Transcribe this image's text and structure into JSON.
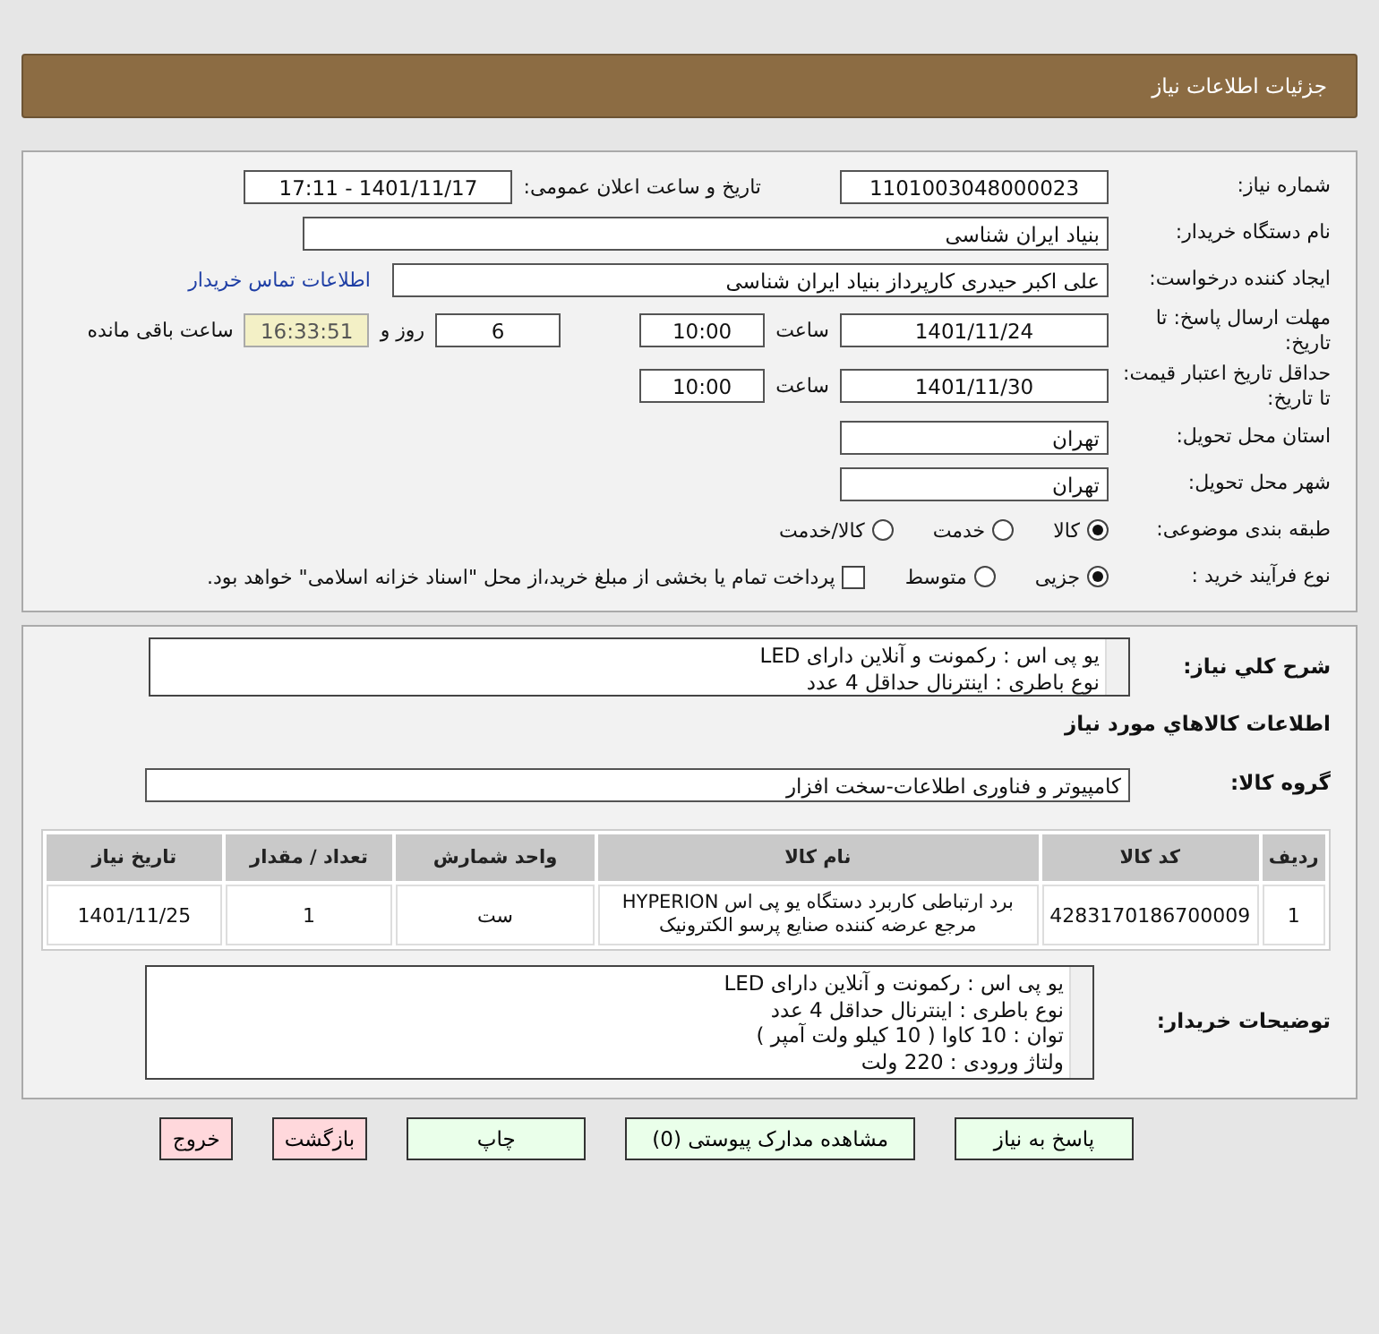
{
  "header": {
    "title": "جزئیات اطلاعات نیاز"
  },
  "details": {
    "need_number": {
      "label": "شماره نیاز:",
      "value": "1101003048000023"
    },
    "announce": {
      "label": "تاریخ و ساعت اعلان عمومی:",
      "value": "1401/11/17 - 17:11"
    },
    "buyer_org": {
      "label": "نام دستگاه خریدار:",
      "value": "بنیاد ایران شناسی"
    },
    "creator": {
      "label": "ایجاد کننده درخواست:",
      "value": "علی اکبر حیدری کارپرداز بنیاد ایران شناسی",
      "link": "اطلاعات تماس خریدار"
    },
    "deadline": {
      "label": "مهلت ارسال پاسخ: تا تاریخ:",
      "date": "1401/11/24",
      "time_label": "ساعت",
      "time": "10:00",
      "days": "6",
      "days_label": "روز و",
      "remaining": "16:33:51",
      "remaining_label": "ساعت باقی مانده"
    },
    "validity": {
      "label": "حداقل تاریخ اعتبار قیمت: تا تاریخ:",
      "date": "1401/11/30",
      "time_label": "ساعت",
      "time": "10:00"
    },
    "province": {
      "label": "استان محل تحویل:",
      "value": "تهران"
    },
    "city": {
      "label": "شهر محل تحویل:",
      "value": "تهران"
    },
    "category": {
      "label": "طبقه بندی موضوعی:",
      "options": [
        {
          "label": "کالا",
          "selected": true
        },
        {
          "label": "خدمت",
          "selected": false
        },
        {
          "label": "کالا/خدمت",
          "selected": false
        }
      ]
    },
    "process": {
      "label": "نوع فرآیند خرید :",
      "options": [
        {
          "label": "جزیی",
          "selected": true
        },
        {
          "label": "متوسط",
          "selected": false
        }
      ],
      "payment": {
        "label": "پرداخت تمام یا بخشی از مبلغ خرید،از محل \"اسناد خزانه اسلامی\" خواهد بود.",
        "checked": false
      }
    }
  },
  "goods": {
    "summary": {
      "label": "شرح کلي نياز:",
      "lines": [
        "یو پی اس : رکمونت و آنلاین دارای LED",
        "نوع باطری : اینترنال حداقل 4 عدد"
      ]
    },
    "section_title": "اطلاعات کالاهاي مورد نياز",
    "group": {
      "label": "گروه کالا:",
      "value": "کامپیوتر و فناوری اطلاعات-سخت افزار"
    },
    "table": {
      "columns": [
        "ردیف",
        "کد کالا",
        "نام کالا",
        "واحد شمارش",
        "تعداد / مقدار",
        "تاریخ نیاز"
      ],
      "rows": [
        [
          "1",
          "4283170186700009",
          "برد ارتباطی کاربرد دستگاه یو پی اس HYPERION مرجع عرضه کننده صنایع پرسو الکترونیک",
          "ست",
          "1",
          "1401/11/25"
        ]
      ]
    },
    "buyer_notes": {
      "label": "توضیحات خریدار:",
      "lines": [
        "یو پی اس : رکمونت و آنلاین دارای LED",
        "نوع باطری : اینترنال حداقل 4 عدد",
        "توان : 10 کاوا ( 10 کیلو ولت آمپر )",
        "ولتاژ ورودی : 220 ولت"
      ]
    }
  },
  "buttons": [
    {
      "label": "پاسخ به نیاز",
      "kind": "action"
    },
    {
      "label": "مشاهده مدارک پیوستی (0)",
      "kind": "action"
    },
    {
      "label": "چاپ",
      "kind": "action"
    },
    {
      "label": "بازگشت",
      "kind": "exit"
    },
    {
      "label": "خروج",
      "kind": "exit"
    }
  ]
}
